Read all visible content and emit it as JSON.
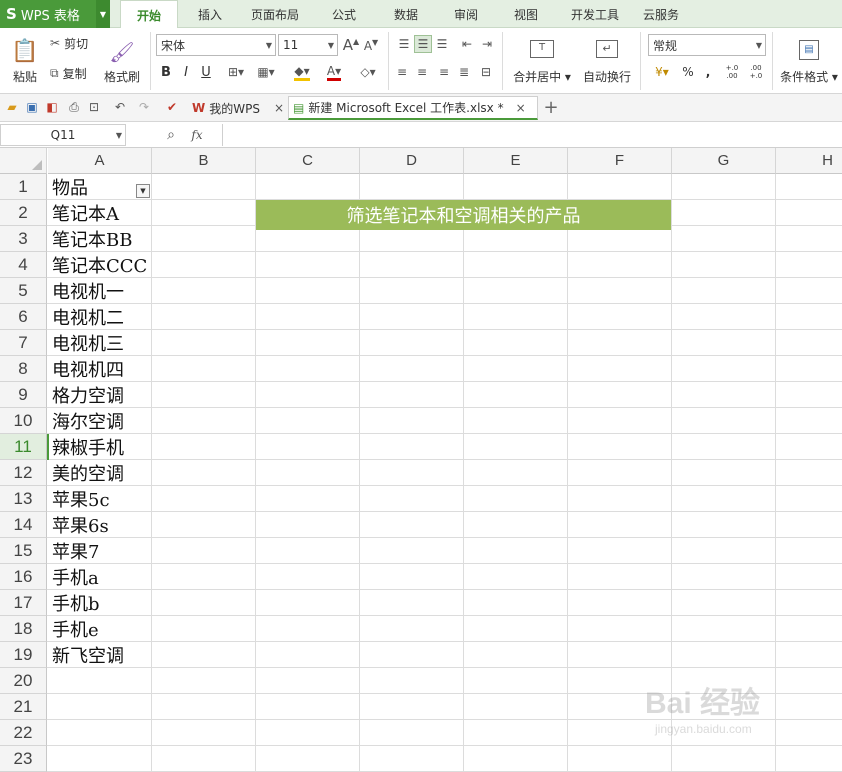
{
  "app": {
    "name": "WPS 表格",
    "logo_glyph": "S"
  },
  "menu_tabs": [
    "开始",
    "插入",
    "页面布局",
    "公式",
    "数据",
    "审阅",
    "视图",
    "开发工具",
    "云服务"
  ],
  "active_tab": "开始",
  "ribbon": {
    "paste": "粘贴",
    "cut": "剪切",
    "copy": "复制",
    "format_painter": "格式刷",
    "font_name": "宋体",
    "font_size": "11",
    "bold": "B",
    "italic": "I",
    "underline": "U",
    "merge_center": "合并居中",
    "wrap_text": "自动换行",
    "number_format": "常规",
    "percent": "%",
    "comma": ",",
    "inc_decimal": "+.0 .00",
    "dec_decimal": ".00 +.0",
    "conditional_format": "条件格式"
  },
  "doc_tabs": [
    {
      "label": "我的WPS"
    },
    {
      "label": "新建 Microsoft Excel 工作表.xlsx *"
    }
  ],
  "formula_bar": {
    "name_box": "Q11",
    "fx": "fx",
    "value": ""
  },
  "columns": [
    "A",
    "B",
    "C",
    "D",
    "E",
    "F",
    "G",
    "H"
  ],
  "rows": [
    "1",
    "2",
    "3",
    "4",
    "5",
    "6",
    "7",
    "8",
    "9",
    "10",
    "11",
    "12",
    "13",
    "14",
    "15",
    "16",
    "17",
    "18",
    "19",
    "20",
    "21",
    "22",
    "23"
  ],
  "selected_row": "11",
  "column_a": [
    "物品",
    "笔记本A",
    "笔记本BB",
    "笔记本CCC",
    "电视机一",
    "电视机二",
    "电视机三",
    "电视机四",
    "格力空调",
    "海尔空调",
    "辣椒手机",
    "美的空调",
    "苹果5c",
    "苹果6s",
    "苹果7",
    "手机a",
    "手机b",
    "手机e",
    "新飞空调"
  ],
  "banner_text": "筛选笔记本和空调相关的产品",
  "colors": {
    "brand": "#4a9a3a",
    "banner": "#9bbb59",
    "active_tab": "#3a8a2c"
  },
  "watermark": {
    "text": "Bai 经验",
    "url": "jingyan.baidu.com"
  }
}
